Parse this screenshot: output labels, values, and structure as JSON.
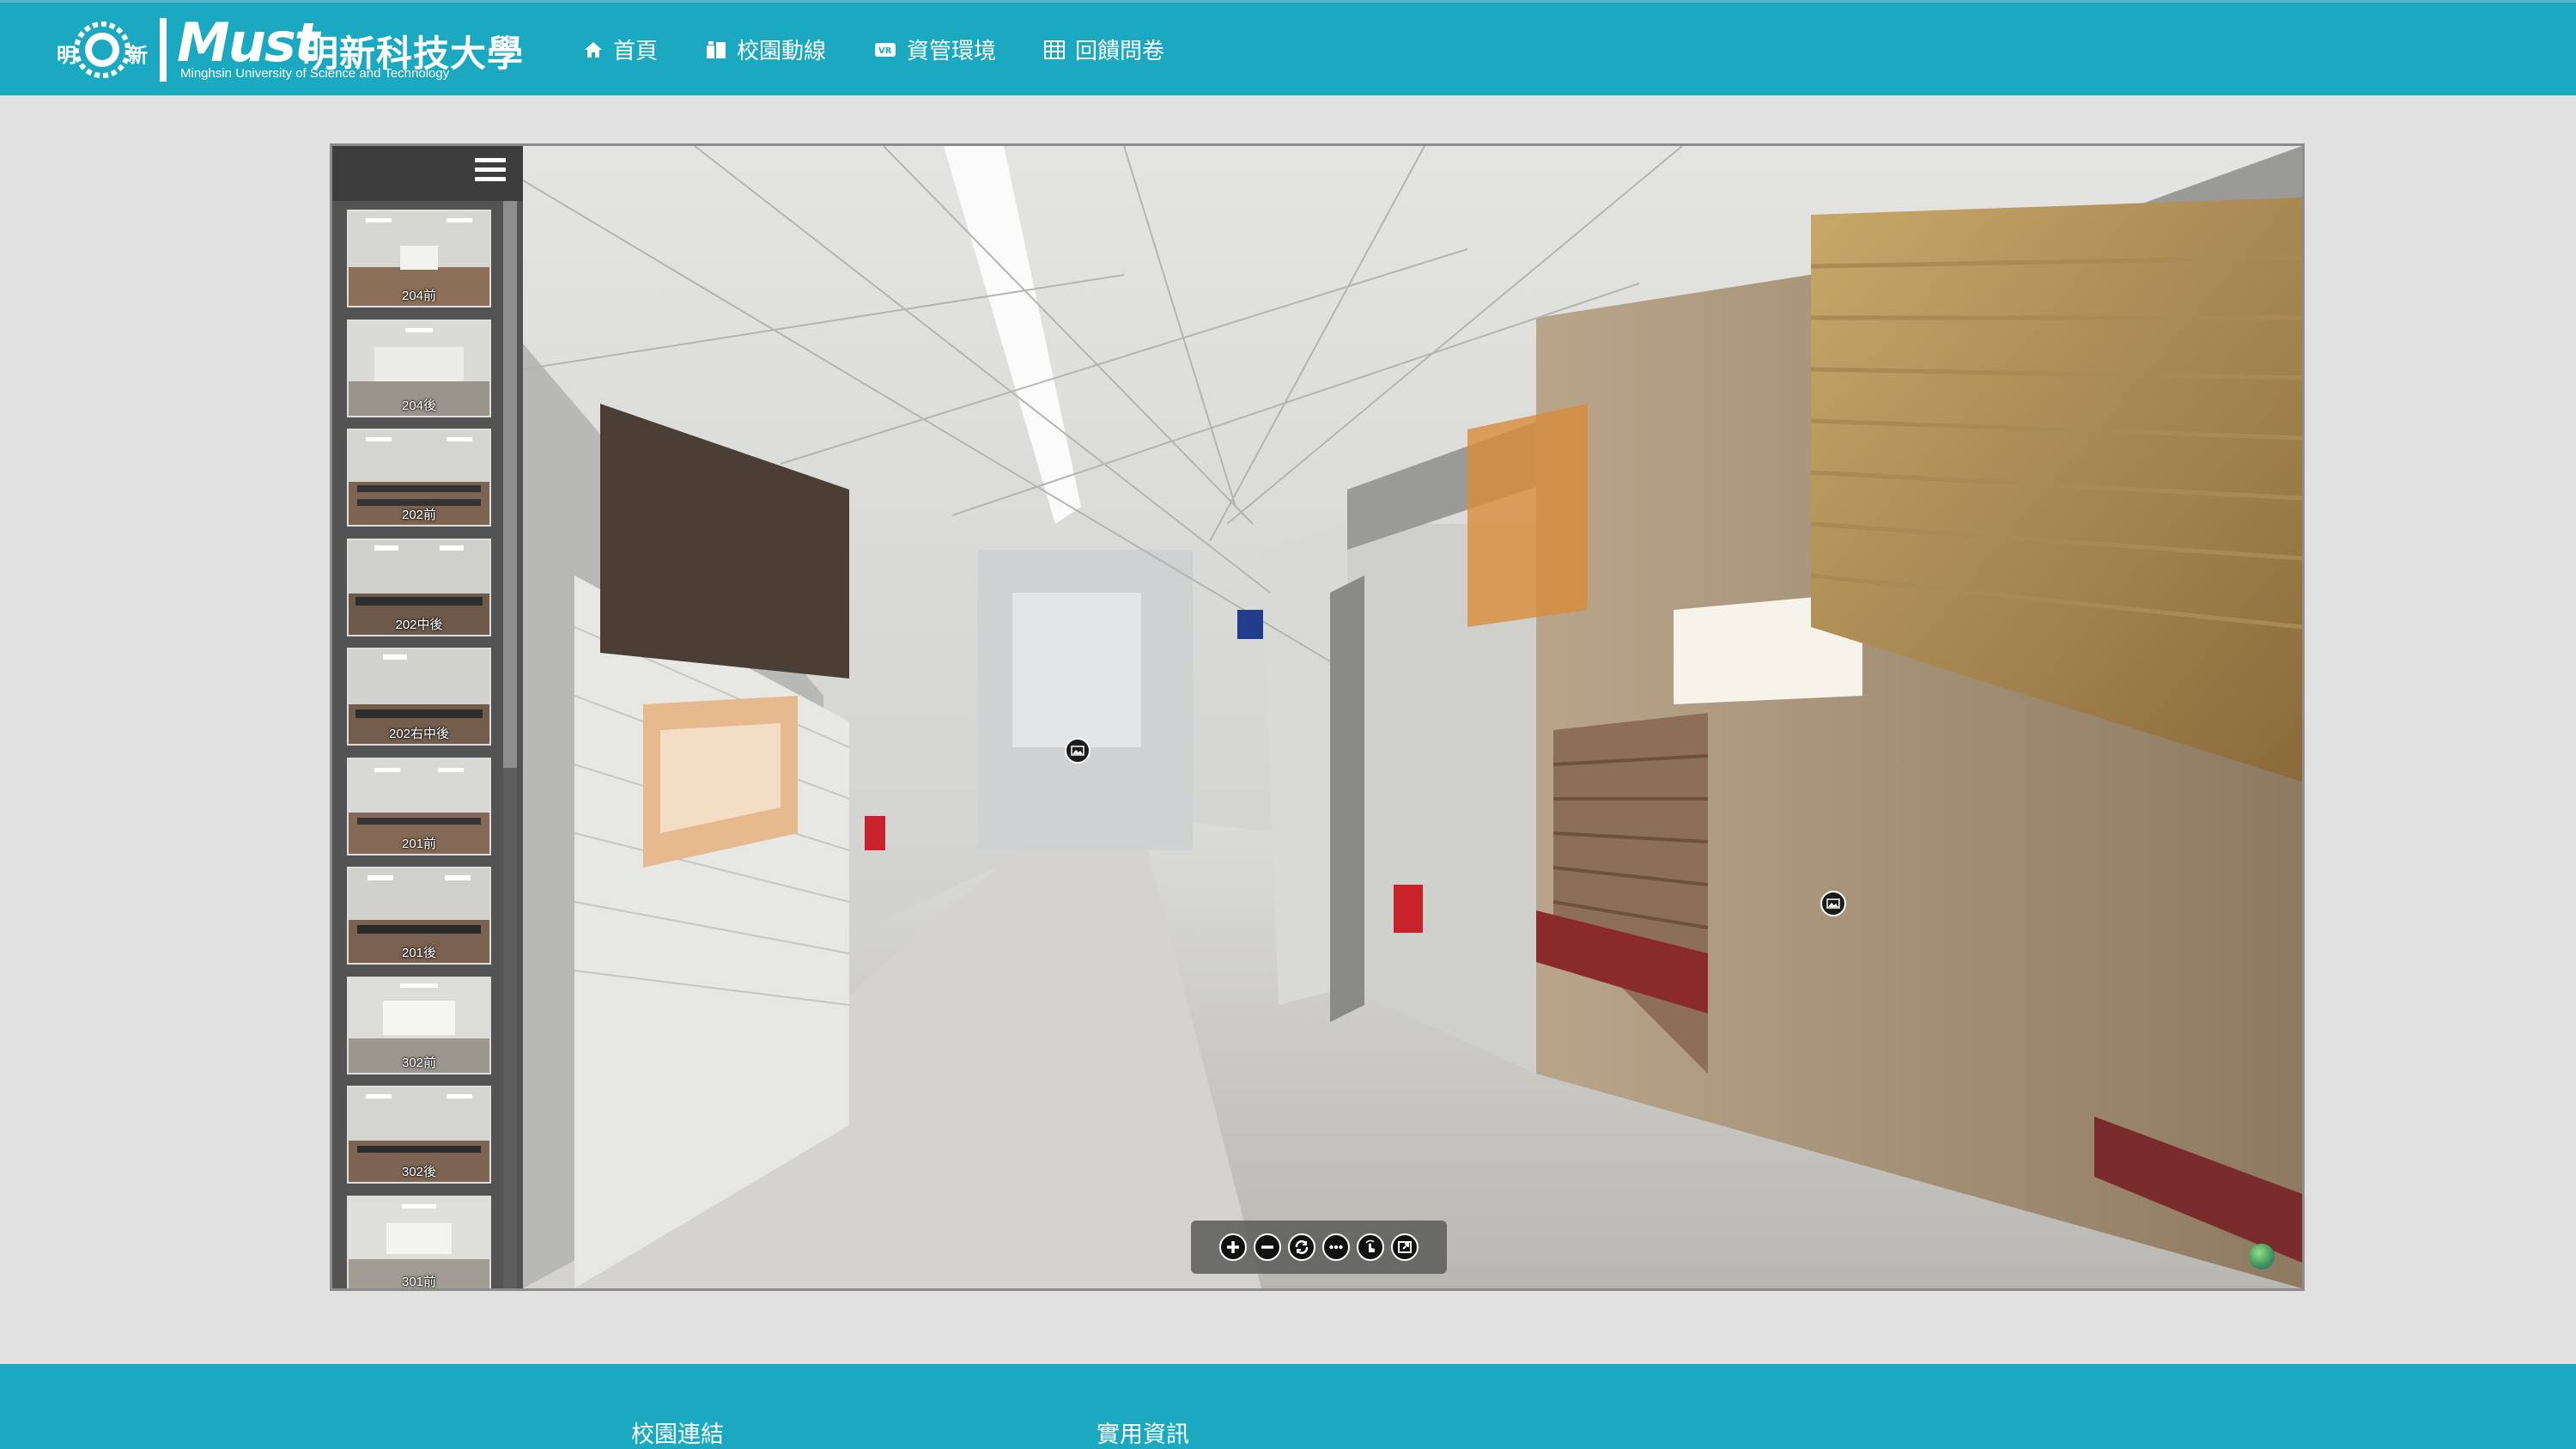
{
  "header": {
    "logo_seal_left": "明",
    "logo_seal_right": "新",
    "logo_wordmark": "Must",
    "logo_name_cn": "明新科技大學",
    "logo_name_en": "Minghsin University of Science and Technology",
    "nav": [
      {
        "label": "首頁",
        "icon": "home-icon"
      },
      {
        "label": "校園動線",
        "icon": "map-icon"
      },
      {
        "label": "資管環境",
        "icon": "vr-icon"
      },
      {
        "label": "回饋問卷",
        "icon": "table-icon"
      }
    ]
  },
  "viewer": {
    "thumbnails": [
      {
        "label": "204前"
      },
      {
        "label": "204後"
      },
      {
        "label": "202前"
      },
      {
        "label": "202中後"
      },
      {
        "label": "202右中後"
      },
      {
        "label": "201前"
      },
      {
        "label": "201後"
      },
      {
        "label": "302前"
      },
      {
        "label": "302後"
      },
      {
        "label": "301前"
      }
    ],
    "toolbar": [
      "zoom-in-icon",
      "zoom-out-icon",
      "autorotate-icon",
      "more-icon",
      "gyro-hand-icon",
      "fullscreen-icon"
    ],
    "colors": {
      "header": "#1aa9c1",
      "page_bg": "#e1e1e1",
      "sidebar": "#505050"
    }
  },
  "footer": {
    "col1_title": "校園連結",
    "col2_title": "實用資訊"
  }
}
